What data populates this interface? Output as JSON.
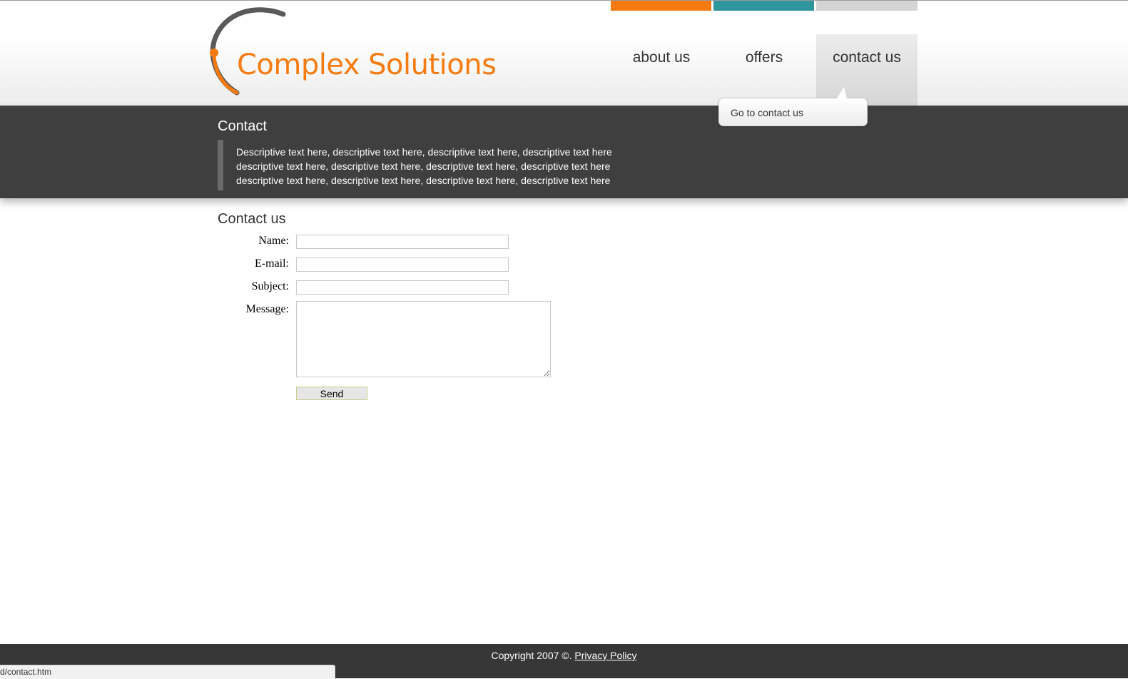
{
  "colors": {
    "orange": "#f57b10",
    "teal": "#2e969c",
    "gray": "#d4d4d4",
    "band": "#3f3f3f"
  },
  "logo": {
    "text": "Complex Solutions"
  },
  "nav": [
    {
      "label": "about us"
    },
    {
      "label": "offers"
    },
    {
      "label": "contact us"
    }
  ],
  "tooltip": {
    "text": "Go to contact us"
  },
  "band": {
    "title": "Contact",
    "description_lines": [
      "Descriptive text here, descriptive text here, descriptive text here, descriptive text here",
      "descriptive text here, descriptive text here, descriptive text here, descriptive text here",
      "descriptive text here, descriptive text here, descriptive text here, descriptive text here"
    ]
  },
  "form": {
    "title": "Contact us",
    "name_label": "Name:",
    "email_label": "E-mail:",
    "subject_label": "Subject:",
    "message_label": "Message:",
    "name_value": "",
    "email_value": "",
    "subject_value": "",
    "message_value": "",
    "send_label": "Send"
  },
  "footer": {
    "copyright": "Copyright 2007 ©. ",
    "privacy_link": "Privacy Policy"
  },
  "status_bar": {
    "url": "d/contact.htm"
  }
}
